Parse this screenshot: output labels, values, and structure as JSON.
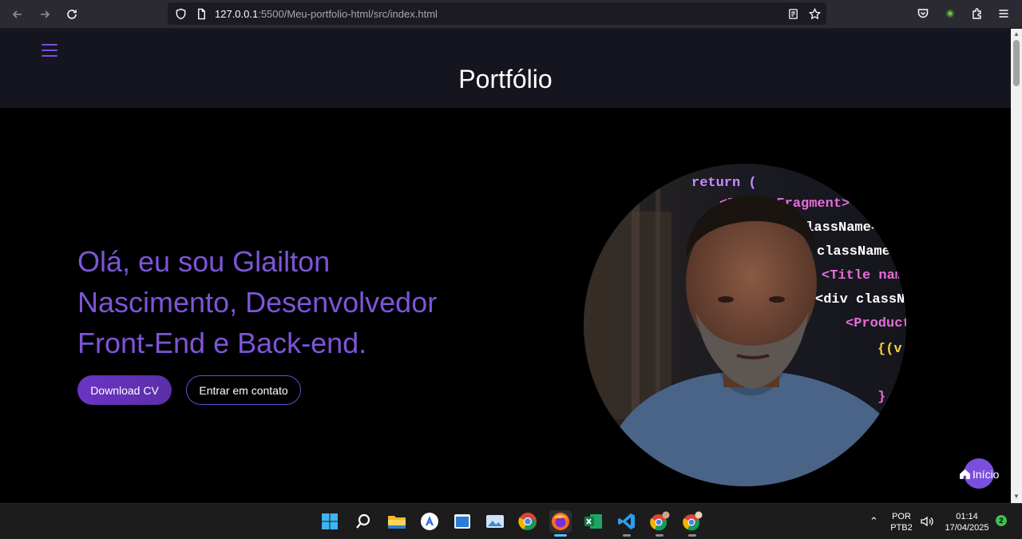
{
  "browser": {
    "url_host": "127.0.0.1",
    "url_rest": ":5500/Meu-portfolio-html/src/index.html"
  },
  "page": {
    "title": "Portfólio",
    "hero_text": "Olá, eu sou Glailton Nascimento, Desenvolvedor Front-End e Back-end.",
    "download_button": "Download CV",
    "contact_button": "Entrar em contato",
    "inicio_label": "Início"
  },
  "colors": {
    "accent": "#7c55d8",
    "header_bg": "#15151f",
    "page_bg": "#000000"
  },
  "taskbar": {
    "language": "POR",
    "layout": "PTB2",
    "time": "01:14",
    "date": "17/04/2025",
    "notifications": "2",
    "apps": [
      "windows-start",
      "search",
      "file-explorer",
      "app-store",
      "app-window",
      "photos",
      "chrome",
      "firefox",
      "excel",
      "vscode",
      "chrome-profile-1",
      "chrome-profile-2"
    ]
  }
}
